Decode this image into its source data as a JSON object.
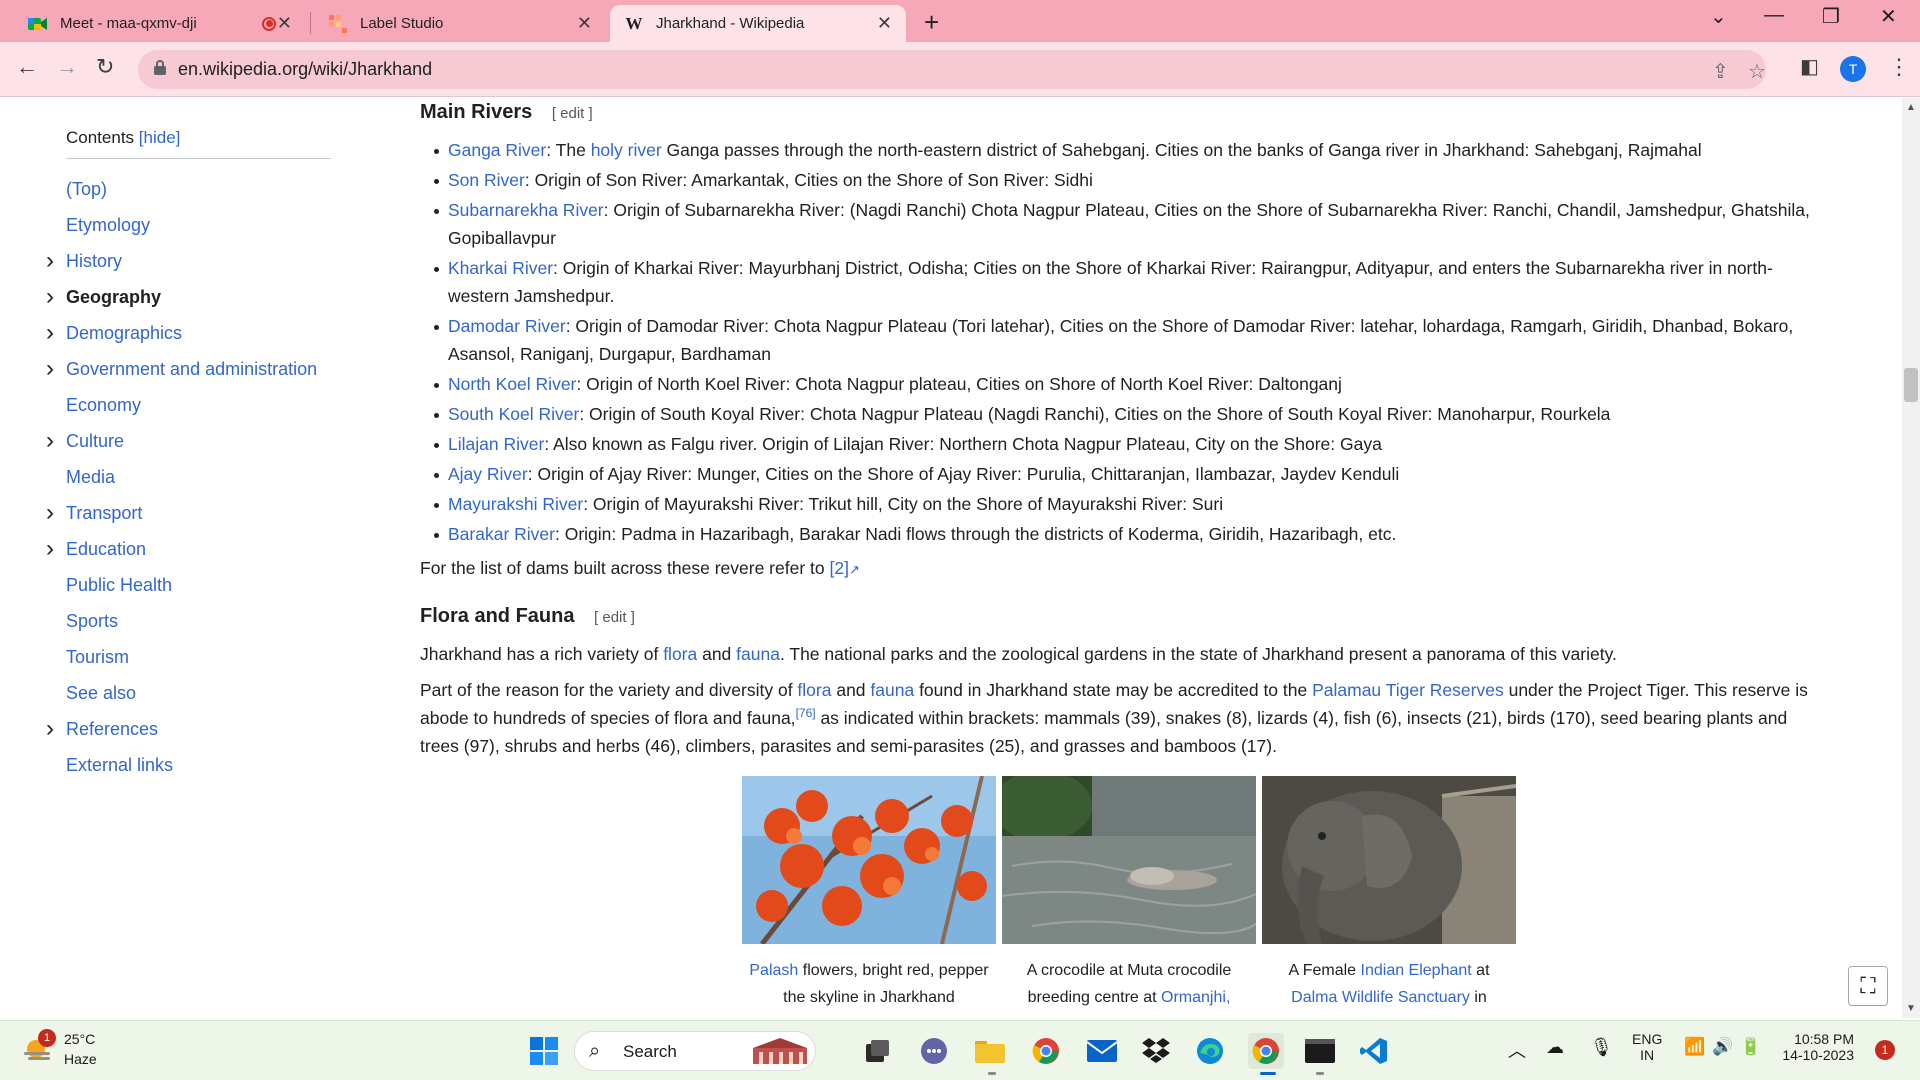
{
  "browser": {
    "tabs": [
      {
        "title": "Meet - maa-qxmv-dji",
        "active": false
      },
      {
        "title": "Label Studio",
        "active": false
      },
      {
        "title": "Jharkhand - Wikipedia",
        "active": true
      }
    ],
    "new_tab_label": "+",
    "url": "en.wikipedia.org/wiki/Jharkhand",
    "profile_initial": "T"
  },
  "toc": {
    "title": "Contents",
    "hide_label": "[hide]",
    "items": [
      {
        "label": "(Top)",
        "expandable": false,
        "current": false
      },
      {
        "label": "Etymology",
        "expandable": false,
        "current": false
      },
      {
        "label": "History",
        "expandable": true,
        "current": false
      },
      {
        "label": "Geography",
        "expandable": true,
        "current": true
      },
      {
        "label": "Demographics",
        "expandable": true,
        "current": false
      },
      {
        "label": "Government and administration",
        "expandable": true,
        "current": false
      },
      {
        "label": "Economy",
        "expandable": false,
        "current": false
      },
      {
        "label": "Culture",
        "expandable": true,
        "current": false
      },
      {
        "label": "Media",
        "expandable": false,
        "current": false
      },
      {
        "label": "Transport",
        "expandable": true,
        "current": false
      },
      {
        "label": "Education",
        "expandable": true,
        "current": false
      },
      {
        "label": "Public Health",
        "expandable": false,
        "current": false
      },
      {
        "label": "Sports",
        "expandable": false,
        "current": false
      },
      {
        "label": "Tourism",
        "expandable": false,
        "current": false
      },
      {
        "label": "See also",
        "expandable": false,
        "current": false
      },
      {
        "label": "References",
        "expandable": true,
        "current": false
      },
      {
        "label": "External links",
        "expandable": false,
        "current": false
      }
    ]
  },
  "rivers_section": {
    "heading": "Main Rivers",
    "edit_label": "[ edit ]",
    "rivers": [
      {
        "name": "Ganga River",
        "pre_link_text": ": The ",
        "extra_link": "holy river",
        "text": " Ganga passes through the north-eastern district of Sahebganj. Cities on the banks of Ganga river in Jharkhand: Sahebganj, Rajmahal"
      },
      {
        "name": "Son River",
        "text": ": Origin of Son River: Amarkantak, Cities on the Shore of Son River: Sidhi"
      },
      {
        "name": "Subarnarekha River",
        "text": ": Origin of Subarnarekha River: (Nagdi Ranchi) Chota Nagpur Plateau, Cities on the Shore of Subarnarekha River: Ranchi, Chandil, Jamshedpur, Ghatshila, Gopiballavpur"
      },
      {
        "name": "Kharkai River",
        "text": ": Origin of Kharkai River: Mayurbhanj District, Odisha; Cities on the Shore of Kharkai River: Rairangpur, Adityapur, and enters the Subarnarekha river in north-western Jamshedpur."
      },
      {
        "name": "Damodar River",
        "text": ": Origin of Damodar River: Chota Nagpur Plateau (Tori latehar), Cities on the Shore of Damodar River: latehar, lohardaga, Ramgarh, Giridih, Dhanbad, Bokaro, Asansol, Raniganj, Durgapur, Bardhaman"
      },
      {
        "name": "North Koel River",
        "text": ": Origin of North Koel River: Chota Nagpur plateau, Cities on Shore of North Koel River: Daltonganj"
      },
      {
        "name": "South Koel River",
        "text": ": Origin of South Koyal River: Chota Nagpur Plateau (Nagdi Ranchi), Cities on the Shore of South Koyal River: Manoharpur, Rourkela"
      },
      {
        "name": "Lilajan River",
        "text": ": Also known as Falgu river. Origin of Lilajan River: Northern Chota Nagpur Plateau, City on the Shore: Gaya"
      },
      {
        "name": "Ajay River",
        "text": ": Origin of Ajay River: Munger, Cities on the Shore of Ajay River: Purulia, Chittaranjan, Ilambazar, Jaydev Kenduli"
      },
      {
        "name": "Mayurakshi River",
        "text": ": Origin of Mayurakshi River: Trikut hill, City on the Shore of Mayurakshi River: Suri"
      },
      {
        "name": "Barakar River",
        "text": ": Origin: Padma in Hazaribagh, Barakar Nadi flows through the districts of Koderma, Giridih, Hazaribagh, etc."
      }
    ],
    "dams_text": "For the list of dams built across these revere refer to ",
    "dams_ref": "[2]"
  },
  "flora_section": {
    "heading": "Flora and Fauna",
    "edit_label": "[ edit ]",
    "para1": {
      "t1": "Jharkhand has a rich variety of ",
      "l1": "flora",
      "t2": " and ",
      "l2": "fauna",
      "t3": ". The national parks and the zoological gardens in the state of Jharkhand present a panorama of this variety."
    },
    "para2": {
      "t1": "Part of the reason for the variety and diversity of ",
      "l1": "flora",
      "t2": " and ",
      "l2": "fauna",
      "t3": " found in Jharkhand state may be accredited to the ",
      "l3": "Palamau Tiger Reserves",
      "t4": " under the Project Tiger. This reserve is abode to hundreds of species of flora and fauna,",
      "ref": "[76]",
      "t5": " as indicated within brackets: mammals (39), snakes (8), lizards (4), fish (6), insects (21), birds (170), seed bearing plants and trees (97), shrubs and herbs (46), climbers, parasites and semi-parasites (25), and grasses and bamboos (17)."
    },
    "gallery": [
      {
        "caption_link": "Palash",
        "caption_text": " flowers, bright red, pepper the skyline in Jharkhand"
      },
      {
        "caption_text_pre": "A crocodile at Muta crocodile breeding centre at ",
        "caption_link": "Ormanjhi,"
      },
      {
        "caption_text_pre": "A Female ",
        "caption_link": "Indian Elephant",
        "caption_text": " at",
        "caption_link2": "Dalma Wildlife Sanctuary",
        "caption_text2": " in"
      }
    ]
  },
  "taskbar": {
    "weather_temp": "25°C",
    "weather_cond": "Haze",
    "weather_badge": "1",
    "search_label": "Search",
    "lang_top": "ENG",
    "lang_bottom": "IN",
    "time": "10:58 PM",
    "date": "14-10-2023",
    "notifications": "1"
  },
  "colors": {
    "tabstrip": "#f7a8b8",
    "toolbar": "#fde2e8",
    "link": "#3366cc",
    "taskbar": "#eef6ea"
  }
}
